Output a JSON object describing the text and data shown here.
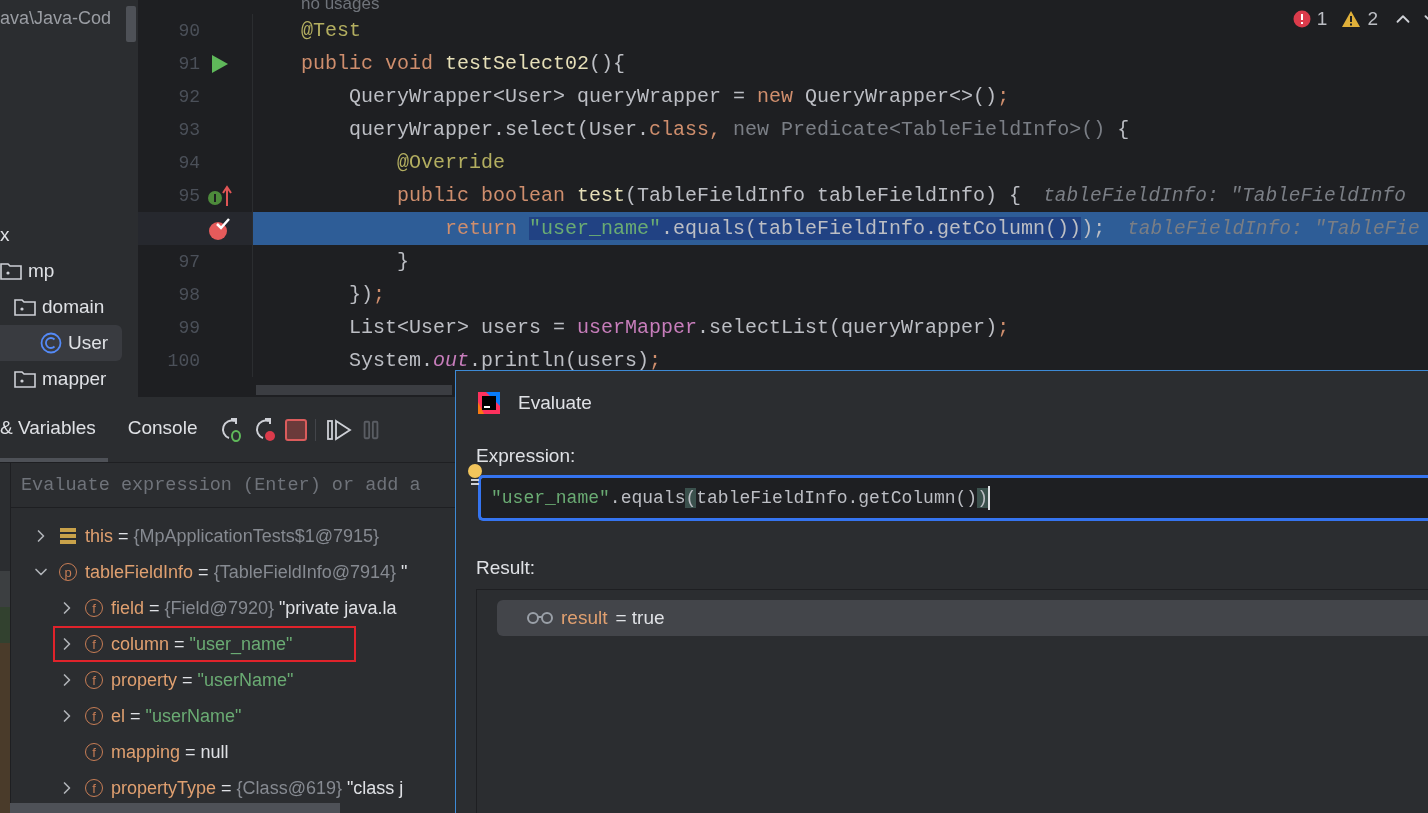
{
  "project_panel": {
    "path": "ava\\Java-Cod",
    "tree": [
      {
        "label": "x",
        "selected": false,
        "children": [
          {
            "label": "mp",
            "kind": "folder",
            "selected": false,
            "children": [
              {
                "label": "domain",
                "kind": "folder",
                "selected": false,
                "children": [
                  {
                    "label": "User",
                    "kind": "class",
                    "selected": true
                  }
                ]
              },
              {
                "label": "mapper",
                "kind": "folder",
                "selected": false
              }
            ]
          }
        ]
      }
    ]
  },
  "editor": {
    "usage_hint": "no usages",
    "problems": {
      "errors": "1",
      "warnings": "2"
    },
    "lines": [
      {
        "number": "90",
        "current": false,
        "tokens": [
          {
            "text": "@Test",
            "kind": "annotation"
          }
        ]
      },
      {
        "number": "91",
        "kind": "run",
        "current": false,
        "tokens": [
          {
            "text": "public void ",
            "kind": "keyword"
          },
          {
            "text": "testSelect02",
            "kind": "method"
          },
          {
            "text": "(){",
            "kind": "plain"
          }
        ],
        "children": [
          {
            "number": "92",
            "current": false,
            "tokens": [
              {
                "text": "QueryWrapper<User> queryWrapper = ",
                "kind": "plain"
              },
              {
                "text": "new ",
                "kind": "keyword"
              },
              {
                "text": "QueryWrapper<>()",
                "kind": "plain"
              },
              {
                "text": ";",
                "kind": "keyword"
              }
            ]
          },
          {
            "number": "93",
            "current": false,
            "tokens": [
              {
                "text": "queryWrapper.select(User.",
                "kind": "plain"
              },
              {
                "text": "class,",
                "kind": "keyword"
              },
              {
                "text": " new Predicate<TableFieldInfo>()",
                "kind": "folded"
              },
              {
                "text": " {",
                "kind": "plain"
              }
            ],
            "children": [
              {
                "number": "94",
                "current": false,
                "tokens": [
                  {
                    "text": "@Override",
                    "kind": "annotation"
                  }
                ]
              },
              {
                "number": "95",
                "kind": "implements",
                "current": false,
                "tokens": [
                  {
                    "text": "public boolean ",
                    "kind": "keyword"
                  },
                  {
                    "text": "test",
                    "kind": "method"
                  },
                  {
                    "text": "(TableFieldInfo tableFieldInfo) {",
                    "kind": "plain"
                  }
                ],
                "hint": "tableFieldInfo: \"TableFieldInfo",
                "children": [
                  {
                    "kind": "breakpoint",
                    "current": true,
                    "tokens": [
                      {
                        "text": "return ",
                        "kind": "keyword",
                        "selected": false
                      },
                      {
                        "text": "\"user_name\"",
                        "kind": "string",
                        "selected": true
                      },
                      {
                        "text": ".equals(tableFieldInfo.getColumn())",
                        "kind": "plain",
                        "selected": true
                      },
                      {
                        "text": ");",
                        "kind": "plain",
                        "selected": false
                      }
                    ],
                    "hint": "tableFieldInfo: \"TableFie"
                  }
                ]
              },
              {
                "number": "97",
                "current": false,
                "tokens": [
                  {
                    "text": "}",
                    "kind": "plain"
                  }
                ]
              }
            ]
          },
          {
            "number": "98",
            "current": false,
            "tokens": [
              {
                "text": "})",
                "kind": "plain"
              },
              {
                "text": ";",
                "kind": "keyword"
              }
            ]
          },
          {
            "number": "99",
            "current": false,
            "tokens": [
              {
                "text": "List<User> users = ",
                "kind": "plain"
              },
              {
                "text": "userMapper",
                "kind": "field"
              },
              {
                "text": ".selectList(queryWrapper)",
                "kind": "plain"
              },
              {
                "text": ";",
                "kind": "keyword"
              }
            ]
          },
          {
            "number": "100",
            "current": false,
            "tokens": [
              {
                "text": "System.",
                "kind": "plain"
              },
              {
                "text": "out",
                "kind": "static"
              },
              {
                "text": ".println(users)",
                "kind": "plain"
              },
              {
                "text": ";",
                "kind": "keyword"
              }
            ]
          }
        ]
      }
    ]
  },
  "debug_panel": {
    "tabs": [
      {
        "label": "& Variables",
        "selected": true
      },
      {
        "label": "Console",
        "selected": false
      }
    ],
    "evaluate_field": {
      "placeholder": "Evaluate expression (Enter) or add a"
    },
    "variables": [
      {
        "kind": "this",
        "name": "this",
        "sep": "=",
        "ref": "{MpApplicationTests$1@7915}",
        "expandable": true,
        "expanded": false,
        "highlighted": false
      },
      {
        "kind": "param",
        "badge": "p",
        "name": "tableFieldInfo",
        "sep": "=",
        "ref": "{TableFieldInfo@7914}",
        "value": "\"",
        "value_is_string": false,
        "expandable": true,
        "expanded": true,
        "highlighted": false,
        "children": [
          {
            "kind": "field",
            "badge": "f",
            "name": "field",
            "sep": "=",
            "ref": "{Field@7920}",
            "value": "\"private java.la",
            "value_is_string": false,
            "expandable": true,
            "expanded": false,
            "highlighted": false
          },
          {
            "kind": "field",
            "badge": "f",
            "name": "column",
            "sep": "=",
            "value": "\"user_name\"",
            "value_is_string": true,
            "expandable": true,
            "expanded": false,
            "highlighted": true
          },
          {
            "kind": "field",
            "badge": "f",
            "name": "property",
            "sep": "=",
            "value": "\"userName\"",
            "value_is_string": true,
            "expandable": true,
            "expanded": false,
            "highlighted": false
          },
          {
            "kind": "field",
            "badge": "f",
            "name": "el",
            "sep": "=",
            "value": "\"userName\"",
            "value_is_string": true,
            "expandable": true,
            "expanded": false,
            "highlighted": false
          },
          {
            "kind": "field",
            "badge": "f",
            "name": "mapping",
            "sep": "=",
            "value": "null",
            "value_is_string": false,
            "expandable": false,
            "highlighted": false
          },
          {
            "kind": "field",
            "badge": "f",
            "name": "propertyType",
            "sep": "=",
            "ref": "{Class@619}",
            "value": "\"class j",
            "value_is_string": false,
            "expandable": true,
            "expanded": false,
            "highlighted": false
          }
        ]
      }
    ]
  },
  "evaluate_dialog": {
    "title": "Evaluate",
    "expression_label": "Expression:",
    "expression": [
      {
        "text": "\"user_name\"",
        "kind": "string",
        "matched": false
      },
      {
        "text": ".equals",
        "kind": "plain",
        "matched": false
      },
      {
        "text": "(",
        "kind": "plain",
        "matched": true
      },
      {
        "text": "tableFieldInfo.getColumn()",
        "kind": "plain",
        "matched": false
      },
      {
        "text": ")",
        "kind": "plain",
        "matched": true
      }
    ],
    "result_label": "Result:",
    "result": {
      "name": "result",
      "value": "= true"
    }
  }
}
